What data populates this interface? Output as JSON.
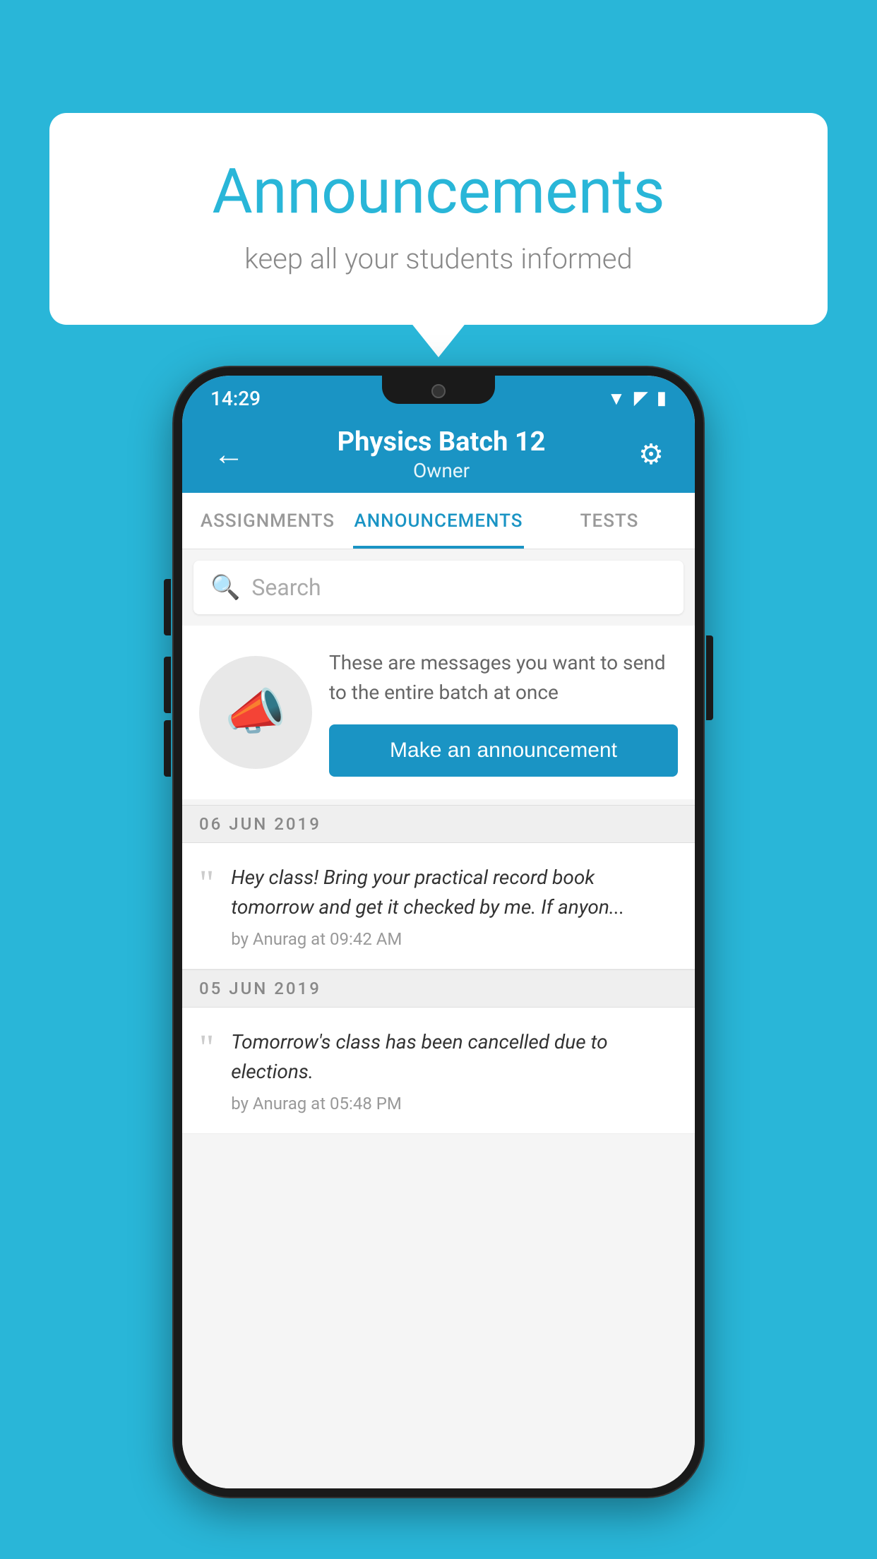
{
  "background_color": "#29b6d8",
  "speech_bubble": {
    "title": "Announcements",
    "subtitle": "keep all your students informed"
  },
  "phone": {
    "status_bar": {
      "time": "14:29",
      "wifi": "▲",
      "signal": "▲",
      "battery": "▮"
    },
    "app_bar": {
      "back_label": "←",
      "title": "Physics Batch 12",
      "subtitle": "Owner",
      "settings_label": "⚙"
    },
    "tabs": [
      {
        "label": "ASSIGNMENTS",
        "active": false
      },
      {
        "label": "ANNOUNCEMENTS",
        "active": true
      },
      {
        "label": "TESTS",
        "active": false
      }
    ],
    "search": {
      "placeholder": "Search"
    },
    "promo": {
      "text": "These are messages you want to send to the entire batch at once",
      "button_label": "Make an announcement"
    },
    "announcements": [
      {
        "date": "06  JUN  2019",
        "text": "Hey class! Bring your practical record book tomorrow and get it checked by me. If anyon...",
        "meta": "by Anurag at 09:42 AM"
      },
      {
        "date": "05  JUN  2019",
        "text": "Tomorrow's class has been cancelled due to elections.",
        "meta": "by Anurag at 05:48 PM"
      }
    ]
  }
}
